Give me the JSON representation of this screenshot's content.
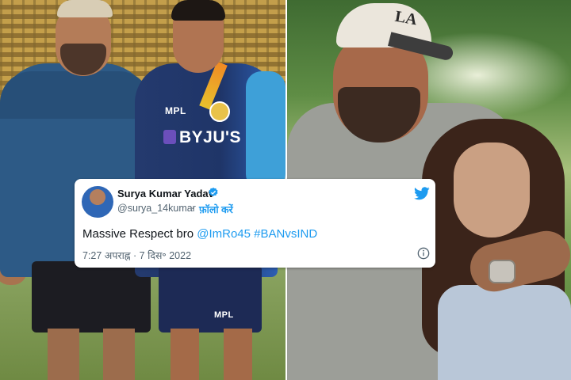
{
  "tweet": {
    "name": "Surya Kumar Yadav",
    "handle": "@surya_14kumar",
    "separator": "·",
    "follow_label": "फ़ॉलो करें",
    "text_plain": "Massive Respect bro",
    "mention": "@ImRo45",
    "hashtag": "#BANvsIND",
    "timestamp": "7:27 अपराह्न · 7 दिस॰ 2022",
    "icons": [
      "verified-badge-icon",
      "twitter-bird-icon",
      "info-icon"
    ],
    "accent_color": "#1d9bf0"
  },
  "left_photo": {
    "jersey_sponsor": "BYJU'S",
    "chest_logo": "MPL",
    "shorts_logo": "MPL"
  },
  "right_photo": {
    "cap_logo": "LA"
  }
}
